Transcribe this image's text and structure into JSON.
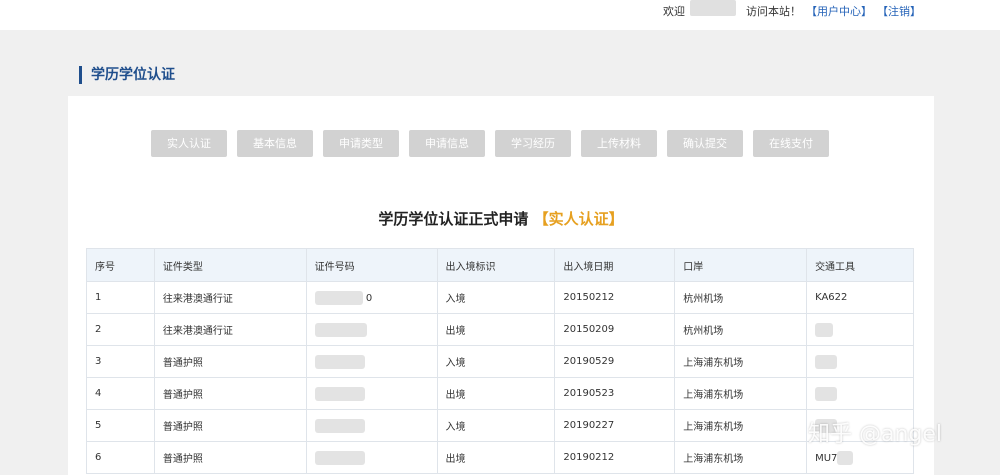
{
  "topbar": {
    "welcome": "欢迎",
    "visit": "访问本站！",
    "user_center": "【用户中心】",
    "logout": "【注销】"
  },
  "page": {
    "section_title": "学历学位认证",
    "heading_main": "学历学位认证正式申请",
    "heading_tag": "【实人认证】"
  },
  "steps": [
    "实人认证",
    "基本信息",
    "申请类型",
    "申请信息",
    "学习经历",
    "上传材料",
    "确认提交",
    "在线支付"
  ],
  "table": {
    "headers": [
      "序号",
      "证件类型",
      "证件号码",
      "出入境标识",
      "出入境日期",
      "口岸",
      "交通工具"
    ],
    "rows": [
      {
        "no": "1",
        "doc_type": "往来港澳通行证",
        "doc_no": "0",
        "flag": "入境",
        "date": "20150212",
        "port": "杭州机场",
        "transport": "KA622"
      },
      {
        "no": "2",
        "doc_type": "往来港澳通行证",
        "doc_no": "",
        "flag": "出境",
        "date": "20150209",
        "port": "杭州机场",
        "transport": ""
      },
      {
        "no": "3",
        "doc_type": "普通护照",
        "doc_no": "",
        "flag": "入境",
        "date": "20190529",
        "port": "上海浦东机场",
        "transport": ""
      },
      {
        "no": "4",
        "doc_type": "普通护照",
        "doc_no": "",
        "flag": "出境",
        "date": "20190523",
        "port": "上海浦东机场",
        "transport": ""
      },
      {
        "no": "5",
        "doc_type": "普通护照",
        "doc_no": "",
        "flag": "入境",
        "date": "20190227",
        "port": "上海浦东机场",
        "transport": ""
      },
      {
        "no": "6",
        "doc_type": "普通护照",
        "doc_no": "",
        "flag": "出境",
        "date": "20190212",
        "port": "上海浦东机场",
        "transport": "MU7"
      }
    ]
  },
  "watermark": "知乎 @angel"
}
